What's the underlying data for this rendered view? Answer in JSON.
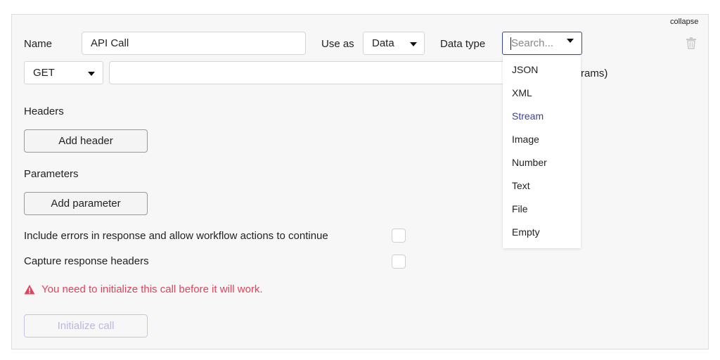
{
  "header": {
    "collapse_label": "collapse"
  },
  "name_field": {
    "label": "Name",
    "value": "API Call"
  },
  "use_as": {
    "label": "Use as",
    "selected": "Data"
  },
  "data_type": {
    "label": "Data type",
    "placeholder": "Search...",
    "options": [
      "JSON",
      "XML",
      "Stream",
      "Image",
      "Number",
      "Text",
      "File",
      "Empty"
    ],
    "highlighted": "Stream"
  },
  "method": {
    "selected": "GET"
  },
  "url": {
    "value": "",
    "trailing_text": "rams)"
  },
  "headers": {
    "label": "Headers",
    "add_button": "Add header"
  },
  "parameters": {
    "label": "Parameters",
    "add_button": "Add parameter"
  },
  "options": {
    "include_errors_label": "Include errors in response and allow workflow actions to continue",
    "include_errors_checked": false,
    "capture_headers_label": "Capture response headers",
    "capture_headers_checked": false
  },
  "warning": {
    "text": "You need to initialize this call before it will work."
  },
  "initialize_button": {
    "label": "Initialize call"
  },
  "colors": {
    "accent": "#3742a8",
    "warning": "#e3425b",
    "disabled_text": "#bab6e6"
  },
  "icons": {
    "trash": "trash-icon",
    "warning": "warning-triangle-icon",
    "caret": "caret-down-icon"
  }
}
